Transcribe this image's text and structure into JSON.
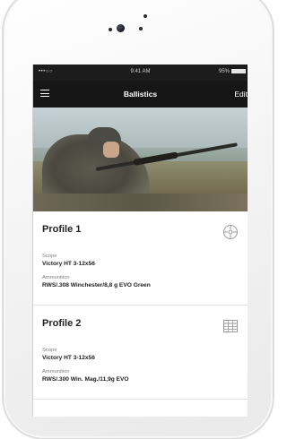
{
  "status_bar": {
    "signal": "•••○○",
    "time": "9:41 AM",
    "battery": "95%"
  },
  "navbar": {
    "title": "Ballistics",
    "edit_label": "Edit",
    "menu_icon": "menu-icon"
  },
  "profiles": [
    {
      "title": "Profile 1",
      "icon": "crosshair-icon",
      "scope_label": "Scope",
      "scope_value": "Victory HT 3-12x56",
      "ammo_label": "Ammunition",
      "ammo_value": "RWS/.308 Winchester/8,8 g EVO Green"
    },
    {
      "title": "Profile 2",
      "icon": "table-icon",
      "scope_label": "Scope",
      "scope_value": "Victory HT 3-12x56",
      "ammo_label": "Ammunition",
      "ammo_value": "RWS/.300 Win. Mag./11,9g EVO"
    }
  ],
  "colors": {
    "navbar": "#161616",
    "text_primary": "#222222",
    "text_secondary": "#808080"
  }
}
